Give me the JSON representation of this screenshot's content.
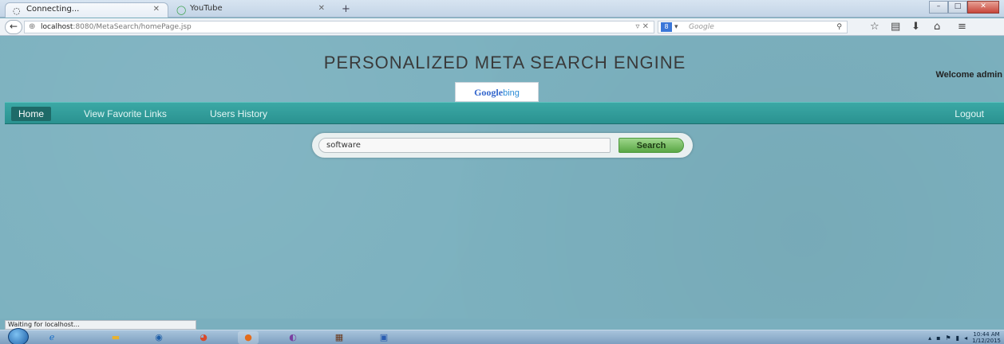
{
  "browser": {
    "tabs": [
      {
        "label": "Connecting...",
        "icon": "loading-icon"
      },
      {
        "label": "YouTube",
        "icon": "youtube-icon"
      }
    ],
    "new_tab_label": "+",
    "url_host": "localhost",
    "url_path": ":8080/MetaSearch/homePage.jsp",
    "search_placeholder": "Google",
    "search_engine_badge": "8"
  },
  "page": {
    "title": "PERSONALIZED META SEARCH ENGINE",
    "welcome": "Welcome admin",
    "logo_google": "Google",
    "logo_bing": "bing",
    "menu": {
      "home": "Home",
      "favorites": "View Favorite Links",
      "history": "Users History",
      "logout": "Logout"
    },
    "search": {
      "query": "software",
      "button": "Search"
    }
  },
  "status_text": "Waiting for localhost...",
  "taskbar": {
    "time": "10:44 AM",
    "date": "1/12/2015"
  }
}
